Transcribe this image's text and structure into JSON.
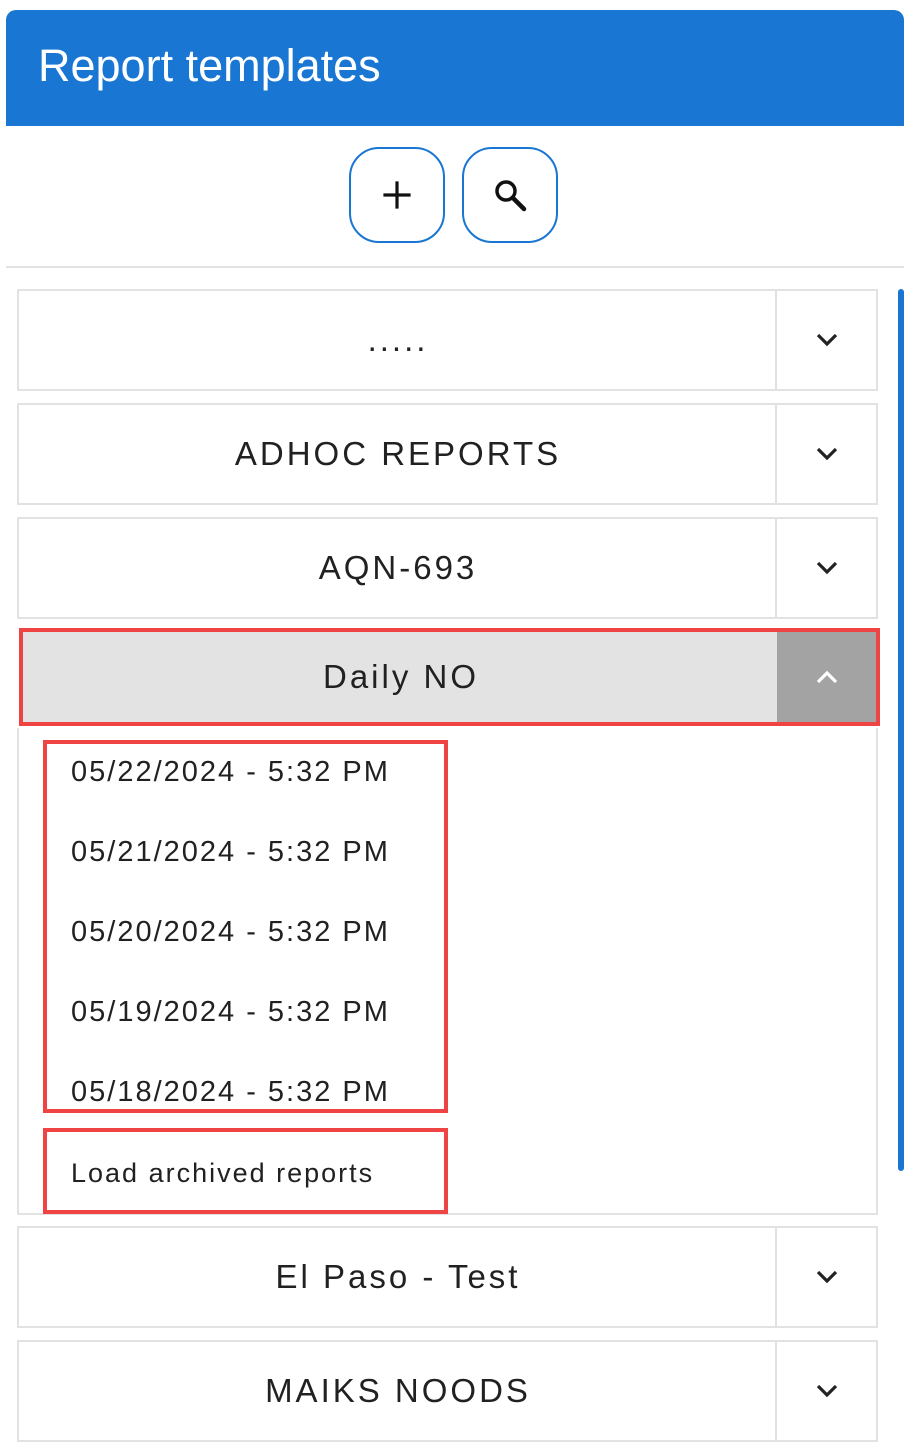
{
  "header": {
    "title": "Report templates"
  },
  "toolbar": {
    "add_icon": "plus-icon",
    "search_icon": "search-icon"
  },
  "groups": [
    {
      "label": ".....",
      "state": "collapsed",
      "toggle_icon": "chevron-down-icon"
    },
    {
      "label": "ADHOC REPORTS",
      "state": "collapsed",
      "toggle_icon": "chevron-down-icon"
    },
    {
      "label": "AQN-693",
      "state": "collapsed",
      "toggle_icon": "chevron-down-icon"
    },
    {
      "label": "Daily NO",
      "state": "expanded",
      "toggle_icon": "chevron-up-icon"
    },
    {
      "label": "El Paso - Test",
      "state": "collapsed",
      "toggle_icon": "chevron-down-icon"
    },
    {
      "label": "MAIKS NOODS",
      "state": "collapsed",
      "toggle_icon": "chevron-down-icon"
    }
  ],
  "daily_no_reports": [
    "05/22/2024 - 5:32 PM",
    "05/21/2024 - 5:32 PM",
    "05/20/2024 - 5:32 PM",
    "05/19/2024 - 5:32 PM",
    "05/18/2024 - 5:32 PM"
  ],
  "load_archived_label": "Load archived reports",
  "colors": {
    "header_bg": "#1976d2",
    "highlight_border": "#ef4444",
    "expanded_bg": "#e3e3e3",
    "expanded_toggle_bg": "#a3a3a3"
  }
}
